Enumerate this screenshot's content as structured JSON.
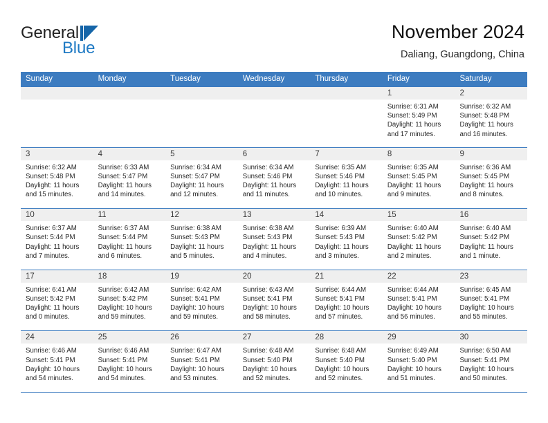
{
  "brand": {
    "name_part1": "General",
    "name_part2": "Blue",
    "mark": "triangle-sail-logo",
    "accent_color": "#1565a8"
  },
  "header": {
    "title": "November 2024",
    "subtitle": "Daliang, Guangdong, China"
  },
  "theme": {
    "header_blue": "#3d7cc0",
    "day_band_gray": "#efefef",
    "text_color": "#262626"
  },
  "calendar": {
    "weekdays": [
      "Sunday",
      "Monday",
      "Tuesday",
      "Wednesday",
      "Thursday",
      "Friday",
      "Saturday"
    ],
    "weeks": [
      [
        {
          "date": "",
          "sunrise": "",
          "sunset": "",
          "daylight_line1": "",
          "daylight_line2": "",
          "empty": true
        },
        {
          "date": "",
          "sunrise": "",
          "sunset": "",
          "daylight_line1": "",
          "daylight_line2": "",
          "empty": true
        },
        {
          "date": "",
          "sunrise": "",
          "sunset": "",
          "daylight_line1": "",
          "daylight_line2": "",
          "empty": true
        },
        {
          "date": "",
          "sunrise": "",
          "sunset": "",
          "daylight_line1": "",
          "daylight_line2": "",
          "empty": true
        },
        {
          "date": "",
          "sunrise": "",
          "sunset": "",
          "daylight_line1": "",
          "daylight_line2": "",
          "empty": true
        },
        {
          "date": "1",
          "sunrise": "Sunrise: 6:31 AM",
          "sunset": "Sunset: 5:49 PM",
          "daylight_line1": "Daylight: 11 hours",
          "daylight_line2": "and 17 minutes."
        },
        {
          "date": "2",
          "sunrise": "Sunrise: 6:32 AM",
          "sunset": "Sunset: 5:48 PM",
          "daylight_line1": "Daylight: 11 hours",
          "daylight_line2": "and 16 minutes."
        }
      ],
      [
        {
          "date": "3",
          "sunrise": "Sunrise: 6:32 AM",
          "sunset": "Sunset: 5:48 PM",
          "daylight_line1": "Daylight: 11 hours",
          "daylight_line2": "and 15 minutes."
        },
        {
          "date": "4",
          "sunrise": "Sunrise: 6:33 AM",
          "sunset": "Sunset: 5:47 PM",
          "daylight_line1": "Daylight: 11 hours",
          "daylight_line2": "and 14 minutes."
        },
        {
          "date": "5",
          "sunrise": "Sunrise: 6:34 AM",
          "sunset": "Sunset: 5:47 PM",
          "daylight_line1": "Daylight: 11 hours",
          "daylight_line2": "and 12 minutes."
        },
        {
          "date": "6",
          "sunrise": "Sunrise: 6:34 AM",
          "sunset": "Sunset: 5:46 PM",
          "daylight_line1": "Daylight: 11 hours",
          "daylight_line2": "and 11 minutes."
        },
        {
          "date": "7",
          "sunrise": "Sunrise: 6:35 AM",
          "sunset": "Sunset: 5:46 PM",
          "daylight_line1": "Daylight: 11 hours",
          "daylight_line2": "and 10 minutes."
        },
        {
          "date": "8",
          "sunrise": "Sunrise: 6:35 AM",
          "sunset": "Sunset: 5:45 PM",
          "daylight_line1": "Daylight: 11 hours",
          "daylight_line2": "and 9 minutes."
        },
        {
          "date": "9",
          "sunrise": "Sunrise: 6:36 AM",
          "sunset": "Sunset: 5:45 PM",
          "daylight_line1": "Daylight: 11 hours",
          "daylight_line2": "and 8 minutes."
        }
      ],
      [
        {
          "date": "10",
          "sunrise": "Sunrise: 6:37 AM",
          "sunset": "Sunset: 5:44 PM",
          "daylight_line1": "Daylight: 11 hours",
          "daylight_line2": "and 7 minutes."
        },
        {
          "date": "11",
          "sunrise": "Sunrise: 6:37 AM",
          "sunset": "Sunset: 5:44 PM",
          "daylight_line1": "Daylight: 11 hours",
          "daylight_line2": "and 6 minutes."
        },
        {
          "date": "12",
          "sunrise": "Sunrise: 6:38 AM",
          "sunset": "Sunset: 5:43 PM",
          "daylight_line1": "Daylight: 11 hours",
          "daylight_line2": "and 5 minutes."
        },
        {
          "date": "13",
          "sunrise": "Sunrise: 6:38 AM",
          "sunset": "Sunset: 5:43 PM",
          "daylight_line1": "Daylight: 11 hours",
          "daylight_line2": "and 4 minutes."
        },
        {
          "date": "14",
          "sunrise": "Sunrise: 6:39 AM",
          "sunset": "Sunset: 5:43 PM",
          "daylight_line1": "Daylight: 11 hours",
          "daylight_line2": "and 3 minutes."
        },
        {
          "date": "15",
          "sunrise": "Sunrise: 6:40 AM",
          "sunset": "Sunset: 5:42 PM",
          "daylight_line1": "Daylight: 11 hours",
          "daylight_line2": "and 2 minutes."
        },
        {
          "date": "16",
          "sunrise": "Sunrise: 6:40 AM",
          "sunset": "Sunset: 5:42 PM",
          "daylight_line1": "Daylight: 11 hours",
          "daylight_line2": "and 1 minute."
        }
      ],
      [
        {
          "date": "17",
          "sunrise": "Sunrise: 6:41 AM",
          "sunset": "Sunset: 5:42 PM",
          "daylight_line1": "Daylight: 11 hours",
          "daylight_line2": "and 0 minutes."
        },
        {
          "date": "18",
          "sunrise": "Sunrise: 6:42 AM",
          "sunset": "Sunset: 5:42 PM",
          "daylight_line1": "Daylight: 10 hours",
          "daylight_line2": "and 59 minutes."
        },
        {
          "date": "19",
          "sunrise": "Sunrise: 6:42 AM",
          "sunset": "Sunset: 5:41 PM",
          "daylight_line1": "Daylight: 10 hours",
          "daylight_line2": "and 59 minutes."
        },
        {
          "date": "20",
          "sunrise": "Sunrise: 6:43 AM",
          "sunset": "Sunset: 5:41 PM",
          "daylight_line1": "Daylight: 10 hours",
          "daylight_line2": "and 58 minutes."
        },
        {
          "date": "21",
          "sunrise": "Sunrise: 6:44 AM",
          "sunset": "Sunset: 5:41 PM",
          "daylight_line1": "Daylight: 10 hours",
          "daylight_line2": "and 57 minutes."
        },
        {
          "date": "22",
          "sunrise": "Sunrise: 6:44 AM",
          "sunset": "Sunset: 5:41 PM",
          "daylight_line1": "Daylight: 10 hours",
          "daylight_line2": "and 56 minutes."
        },
        {
          "date": "23",
          "sunrise": "Sunrise: 6:45 AM",
          "sunset": "Sunset: 5:41 PM",
          "daylight_line1": "Daylight: 10 hours",
          "daylight_line2": "and 55 minutes."
        }
      ],
      [
        {
          "date": "24",
          "sunrise": "Sunrise: 6:46 AM",
          "sunset": "Sunset: 5:41 PM",
          "daylight_line1": "Daylight: 10 hours",
          "daylight_line2": "and 54 minutes."
        },
        {
          "date": "25",
          "sunrise": "Sunrise: 6:46 AM",
          "sunset": "Sunset: 5:41 PM",
          "daylight_line1": "Daylight: 10 hours",
          "daylight_line2": "and 54 minutes."
        },
        {
          "date": "26",
          "sunrise": "Sunrise: 6:47 AM",
          "sunset": "Sunset: 5:41 PM",
          "daylight_line1": "Daylight: 10 hours",
          "daylight_line2": "and 53 minutes."
        },
        {
          "date": "27",
          "sunrise": "Sunrise: 6:48 AM",
          "sunset": "Sunset: 5:40 PM",
          "daylight_line1": "Daylight: 10 hours",
          "daylight_line2": "and 52 minutes."
        },
        {
          "date": "28",
          "sunrise": "Sunrise: 6:48 AM",
          "sunset": "Sunset: 5:40 PM",
          "daylight_line1": "Daylight: 10 hours",
          "daylight_line2": "and 52 minutes."
        },
        {
          "date": "29",
          "sunrise": "Sunrise: 6:49 AM",
          "sunset": "Sunset: 5:40 PM",
          "daylight_line1": "Daylight: 10 hours",
          "daylight_line2": "and 51 minutes."
        },
        {
          "date": "30",
          "sunrise": "Sunrise: 6:50 AM",
          "sunset": "Sunset: 5:41 PM",
          "daylight_line1": "Daylight: 10 hours",
          "daylight_line2": "and 50 minutes."
        }
      ]
    ]
  }
}
